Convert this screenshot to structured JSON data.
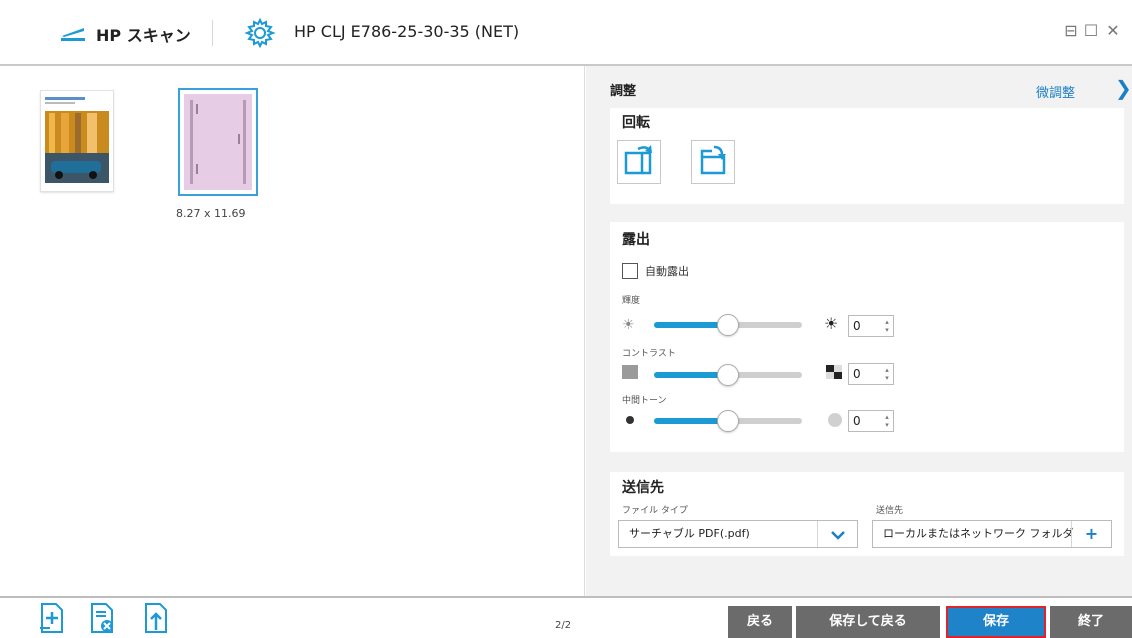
{
  "titlebar": {
    "app_name": "HP スキャン",
    "device_name": "HP CLJ E786-25-30-35 (NET)",
    "min_glyph": "⊟",
    "max_glyph": "☐",
    "close_glyph": "✕"
  },
  "preview": {
    "selected_size": "8.27 x 11.69"
  },
  "panel": {
    "adjust_title": "調整",
    "fine_adjust": "微調整",
    "chevron": "❯",
    "rotate": {
      "title": "回転"
    },
    "exposure": {
      "title": "露出",
      "auto_label": "自動露出",
      "auto_checked": false,
      "brightness_label": "輝度",
      "brightness_value": "0",
      "brightness_level": 0.5,
      "contrast_label": "コントラスト",
      "contrast_value": "0",
      "contrast_level": 0.5,
      "midtone_label": "中間トーン",
      "midtone_value": "0",
      "midtone_level": 0.5
    },
    "destination": {
      "title": "送信先",
      "file_type_label": "ファイル タイプ",
      "file_type_value": "サーチャブル PDF(.pdf)",
      "dest_label": "送信先",
      "dest_value": "ローカルまたはネットワーク フォルダ",
      "dest_add": "+"
    }
  },
  "bottom": {
    "page_count": "2/2",
    "back_button": "戻る",
    "save_back_button": "保存して戻る",
    "save_button": "保存",
    "exit_button": "終了"
  },
  "colors": {
    "accent": "#1c9ad6",
    "save_highlight": "#e0242a",
    "button_gray": "#6b6b6b"
  }
}
